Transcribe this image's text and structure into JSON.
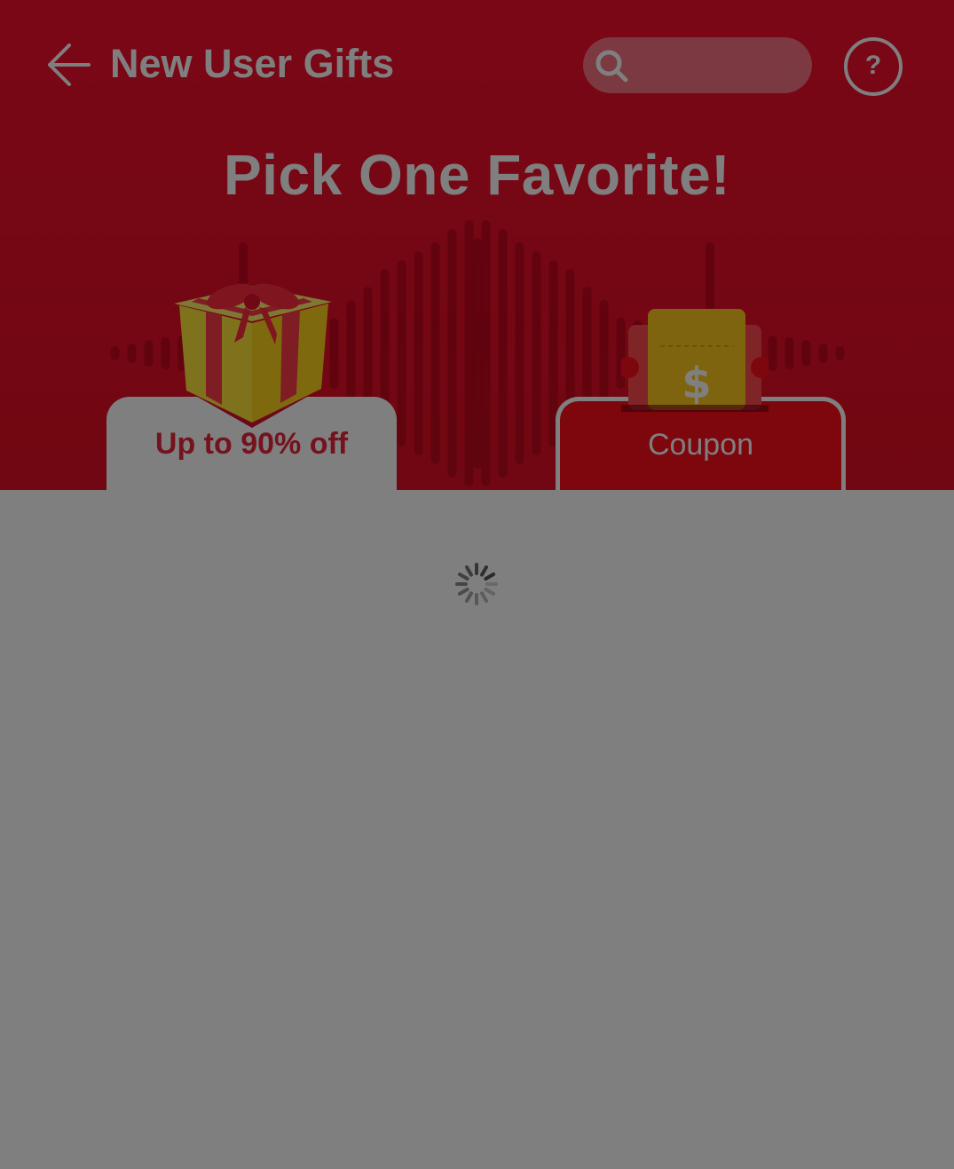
{
  "header": {
    "title": "New User Gifts",
    "back_icon": "arrow-left-icon",
    "search_icon": "search-icon",
    "search_placeholder": "",
    "help_label": "?"
  },
  "hero": {
    "headline": "Pick One Favorite!"
  },
  "tabs": [
    {
      "label": "Up to 90% off",
      "icon": "gift-box-icon",
      "selected": true
    },
    {
      "label": "Coupon",
      "icon": "coupon-ticket-icon",
      "selected": false
    }
  ],
  "content": {
    "loading_icon": "loading-spinner-icon"
  },
  "colors": {
    "brand_red": "#f50f2b",
    "tab_active_text": "#e8263d",
    "overlay": "rgba(0,0,0,0.5)"
  }
}
